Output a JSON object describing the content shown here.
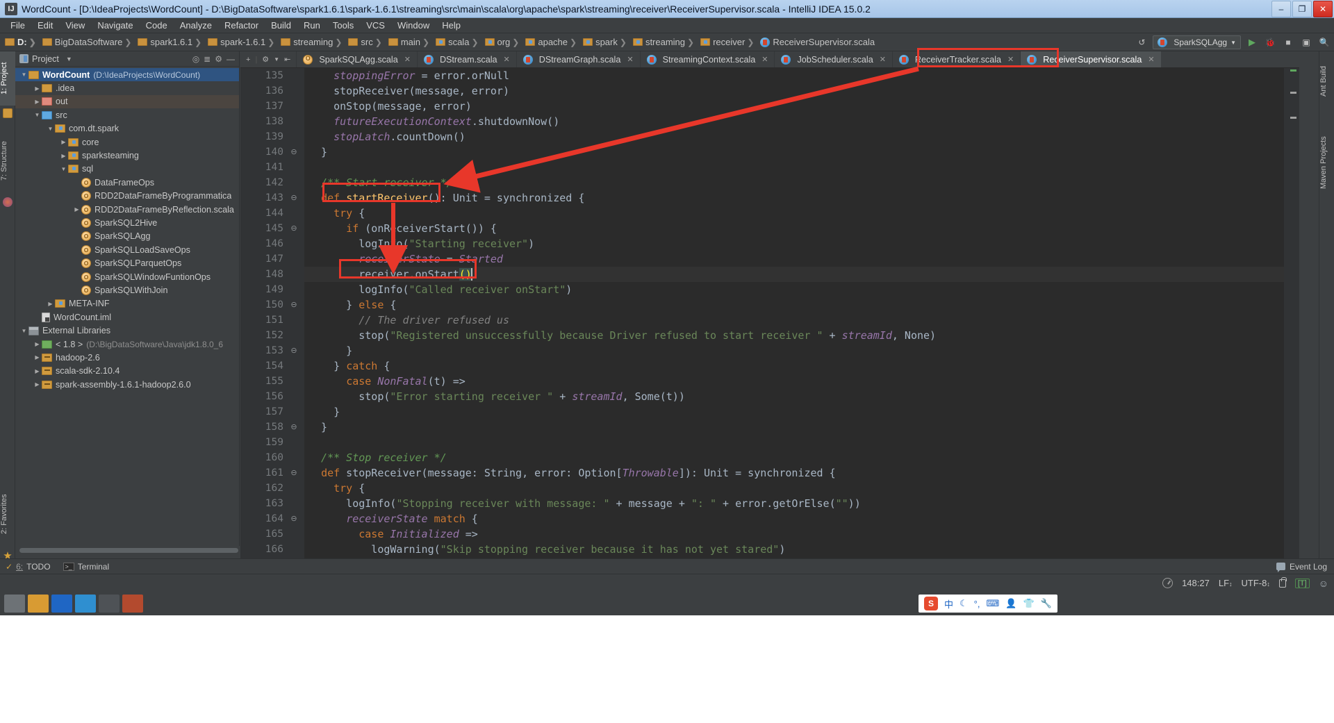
{
  "window": {
    "title": "WordCount - [D:\\IdeaProjects\\WordCount] - D:\\BigDataSoftware\\spark1.6.1\\spark-1.6.1\\streaming\\src\\main\\scala\\org\\apache\\spark\\streaming\\receiver\\ReceiverSupervisor.scala - IntelliJ IDEA 15.0.2",
    "minimize_label": "–",
    "maximize_label": "❐",
    "close_label": "✕",
    "app_icon": "idea-icon"
  },
  "menu": {
    "items": [
      "File",
      "Edit",
      "View",
      "Navigate",
      "Code",
      "Analyze",
      "Refactor",
      "Build",
      "Run",
      "Tools",
      "VCS",
      "Window",
      "Help"
    ]
  },
  "navbar": {
    "crumbs": [
      {
        "label": "D:",
        "icon": "folder-icon",
        "bold": true
      },
      {
        "label": "BigDataSoftware",
        "icon": "folder-icon",
        "bold": false
      },
      {
        "label": "spark1.6.1",
        "icon": "folder-icon",
        "bold": false
      },
      {
        "label": "spark-1.6.1",
        "icon": "folder-icon",
        "bold": false
      },
      {
        "label": "streaming",
        "icon": "folder-icon",
        "bold": false
      },
      {
        "label": "src",
        "icon": "folder-icon",
        "bold": false
      },
      {
        "label": "main",
        "icon": "folder-icon",
        "bold": false
      },
      {
        "label": "scala",
        "icon": "source-folder-icon",
        "bold": false
      },
      {
        "label": "org",
        "icon": "source-folder-icon",
        "bold": false
      },
      {
        "label": "apache",
        "icon": "source-folder-icon",
        "bold": false
      },
      {
        "label": "spark",
        "icon": "source-folder-icon",
        "bold": false
      },
      {
        "label": "streaming",
        "icon": "source-folder-icon",
        "bold": false
      },
      {
        "label": "receiver",
        "icon": "source-folder-icon",
        "bold": false
      },
      {
        "label": "ReceiverSupervisor.scala",
        "icon": "scala-file-icon",
        "bold": false
      }
    ],
    "run_config": "SparkSQLAgg",
    "run_label": "▶",
    "debug_label": "🐞",
    "stop_label": "■",
    "search_label": "🔍",
    "sync_label": "↺"
  },
  "left_tool_strip": {
    "tabs": [
      "1: Project",
      "7: Structure"
    ],
    "favorites": "2: Favorites"
  },
  "right_tool_strip": {
    "tabs": [
      "Ant Build",
      "Maven Projects"
    ]
  },
  "project_panel": {
    "title": "Project",
    "caret": "▼",
    "tree": [
      {
        "depth": 0,
        "arrow": "▼",
        "icon": "project-folder-icon",
        "label": "WordCount",
        "path": "(D:\\IdeaProjects\\WordCount)",
        "bold": true,
        "state": "selected"
      },
      {
        "depth": 1,
        "arrow": "▶",
        "icon": "folder-yellow-icon",
        "label": ".idea",
        "path": "",
        "bold": false,
        "state": "none"
      },
      {
        "depth": 1,
        "arrow": "▶",
        "icon": "folder-red-icon",
        "label": "out",
        "path": "",
        "bold": false,
        "state": "highlight"
      },
      {
        "depth": 1,
        "arrow": "▼",
        "icon": "folder-blue-icon",
        "label": "src",
        "path": "",
        "bold": false,
        "state": "none"
      },
      {
        "depth": 2,
        "arrow": "▼",
        "icon": "package-icon",
        "label": "com.dt.spark",
        "path": "",
        "bold": false,
        "state": "none"
      },
      {
        "depth": 3,
        "arrow": "▶",
        "icon": "package-icon",
        "label": "core",
        "path": "",
        "bold": false,
        "state": "none"
      },
      {
        "depth": 3,
        "arrow": "▶",
        "icon": "package-icon",
        "label": "sparksteaming",
        "path": "",
        "bold": false,
        "state": "none"
      },
      {
        "depth": 3,
        "arrow": "▼",
        "icon": "package-icon",
        "label": "sql",
        "path": "",
        "bold": false,
        "state": "none"
      },
      {
        "depth": 4,
        "arrow": "",
        "icon": "scala-object-icon",
        "label": "DataFrameOps",
        "path": "",
        "bold": false,
        "state": "none"
      },
      {
        "depth": 4,
        "arrow": "",
        "icon": "scala-object-icon",
        "label": "RDD2DataFrameByProgrammatica",
        "path": "",
        "bold": false,
        "state": "none"
      },
      {
        "depth": 4,
        "arrow": "▶",
        "icon": "scala-object-icon",
        "label": "RDD2DataFrameByReflection.scala",
        "path": "",
        "bold": false,
        "state": "none"
      },
      {
        "depth": 4,
        "arrow": "",
        "icon": "scala-object-icon",
        "label": "SparkSQL2Hive",
        "path": "",
        "bold": false,
        "state": "none"
      },
      {
        "depth": 4,
        "arrow": "",
        "icon": "scala-object-icon",
        "label": "SparkSQLAgg",
        "path": "",
        "bold": false,
        "state": "none"
      },
      {
        "depth": 4,
        "arrow": "",
        "icon": "scala-object-icon",
        "label": "SparkSQLLoadSaveOps",
        "path": "",
        "bold": false,
        "state": "none"
      },
      {
        "depth": 4,
        "arrow": "",
        "icon": "scala-object-icon",
        "label": "SparkSQLParquetOps",
        "path": "",
        "bold": false,
        "state": "none"
      },
      {
        "depth": 4,
        "arrow": "",
        "icon": "scala-object-icon",
        "label": "SparkSQLWindowFuntionOps",
        "path": "",
        "bold": false,
        "state": "none"
      },
      {
        "depth": 4,
        "arrow": "",
        "icon": "scala-object-icon",
        "label": "SparkSQLWithJoin",
        "path": "",
        "bold": false,
        "state": "none"
      },
      {
        "depth": 2,
        "arrow": "▶",
        "icon": "package-icon",
        "label": "META-INF",
        "path": "",
        "bold": false,
        "state": "none"
      },
      {
        "depth": 1,
        "arrow": "",
        "icon": "iml-file-icon",
        "label": "WordCount.iml",
        "path": "",
        "bold": false,
        "state": "none"
      },
      {
        "depth": 0,
        "arrow": "▼",
        "icon": "library-icon",
        "label": "External Libraries",
        "path": "",
        "bold": false,
        "state": "none"
      },
      {
        "depth": 1,
        "arrow": "▶",
        "icon": "jdk-icon",
        "label": "< 1.8 >",
        "path": "(D:\\BigDataSoftware\\Java\\jdk1.8.0_6",
        "bold": false,
        "state": "none"
      },
      {
        "depth": 1,
        "arrow": "▶",
        "icon": "jar-icon",
        "label": "hadoop-2.6",
        "path": "",
        "bold": false,
        "state": "none"
      },
      {
        "depth": 1,
        "arrow": "▶",
        "icon": "jar-icon",
        "label": "scala-sdk-2.10.4",
        "path": "",
        "bold": false,
        "state": "none"
      },
      {
        "depth": 1,
        "arrow": "▶",
        "icon": "jar-icon",
        "label": "spark-assembly-1.6.1-hadoop2.6.0",
        "path": "",
        "bold": false,
        "state": "none"
      }
    ]
  },
  "editor_tabs": {
    "tabs": [
      {
        "label": "SparkSQLAgg.scala",
        "icon": "scala-object-icon",
        "active": false,
        "marked": false
      },
      {
        "label": "DStream.scala",
        "icon": "scala-file-icon",
        "active": false,
        "marked": false
      },
      {
        "label": "DStreamGraph.scala",
        "icon": "scala-file-icon",
        "active": false,
        "marked": false
      },
      {
        "label": "StreamingContext.scala",
        "icon": "scala-file-icon",
        "active": false,
        "marked": false
      },
      {
        "label": "JobScheduler.scala",
        "icon": "scala-file-icon",
        "active": false,
        "marked": false
      },
      {
        "label": "ReceiverTracker.scala",
        "icon": "scala-file-icon",
        "active": false,
        "marked": false
      },
      {
        "label": "ReceiverSupervisor.scala",
        "icon": "scala-file-icon",
        "active": true,
        "marked": true
      }
    ],
    "close_label": "✕"
  },
  "editor": {
    "first_line": 135,
    "current_line": 148,
    "lines": [
      {
        "n": 135,
        "fold": "",
        "tokens": [
          {
            "t": "    ",
            "c": "plain"
          },
          {
            "t": "stoppingError",
            "c": "fld"
          },
          {
            "t": " = error.orNull",
            "c": "plain"
          }
        ]
      },
      {
        "n": 136,
        "fold": "",
        "tokens": [
          {
            "t": "    stopReceiver(message, error)",
            "c": "plain"
          }
        ]
      },
      {
        "n": 137,
        "fold": "",
        "tokens": [
          {
            "t": "    onStop(message, error)",
            "c": "plain"
          }
        ]
      },
      {
        "n": 138,
        "fold": "",
        "tokens": [
          {
            "t": "    ",
            "c": "plain"
          },
          {
            "t": "futureExecutionContext",
            "c": "fld"
          },
          {
            "t": ".shutdownNow()",
            "c": "plain"
          }
        ]
      },
      {
        "n": 139,
        "fold": "",
        "tokens": [
          {
            "t": "    ",
            "c": "plain"
          },
          {
            "t": "stopLatch",
            "c": "fld"
          },
          {
            "t": ".countDown()",
            "c": "plain"
          }
        ]
      },
      {
        "n": 140,
        "fold": "⊖",
        "tokens": [
          {
            "t": "  }",
            "c": "plain"
          }
        ]
      },
      {
        "n": 141,
        "fold": "",
        "tokens": [
          {
            "t": "",
            "c": "plain"
          }
        ]
      },
      {
        "n": 142,
        "fold": "",
        "tokens": [
          {
            "t": "  /** Start receiver */",
            "c": "cmt"
          }
        ]
      },
      {
        "n": 143,
        "fold": "⊖",
        "tokens": [
          {
            "t": "  ",
            "c": "plain"
          },
          {
            "t": "def",
            "c": "kw"
          },
          {
            "t": " ",
            "c": "plain"
          },
          {
            "t": "startReceiver",
            "c": "mtd"
          },
          {
            "t": "(): Unit = synchronized {",
            "c": "plain"
          }
        ]
      },
      {
        "n": 144,
        "fold": "",
        "tokens": [
          {
            "t": "    ",
            "c": "plain"
          },
          {
            "t": "try",
            "c": "kw"
          },
          {
            "t": " {",
            "c": "plain"
          }
        ]
      },
      {
        "n": 145,
        "fold": "⊖",
        "tokens": [
          {
            "t": "      ",
            "c": "plain"
          },
          {
            "t": "if",
            "c": "kw"
          },
          {
            "t": " (onReceiverStart()) {",
            "c": "plain"
          }
        ]
      },
      {
        "n": 146,
        "fold": "",
        "tokens": [
          {
            "t": "        logInfo(",
            "c": "plain"
          },
          {
            "t": "\"Starting receiver\"",
            "c": "str"
          },
          {
            "t": ")",
            "c": "plain"
          }
        ]
      },
      {
        "n": 147,
        "fold": "",
        "tokens": [
          {
            "t": "        ",
            "c": "plain"
          },
          {
            "t": "receiverState",
            "c": "fld"
          },
          {
            "t": " = ",
            "c": "plain"
          },
          {
            "t": "Started",
            "c": "fld"
          }
        ]
      },
      {
        "n": 148,
        "fold": "",
        "tokens": [
          {
            "t": "        receiver.onStart",
            "c": "plain"
          },
          {
            "t": "()",
            "c": "caret-par"
          }
        ]
      },
      {
        "n": 149,
        "fold": "",
        "tokens": [
          {
            "t": "        logInfo(",
            "c": "plain"
          },
          {
            "t": "\"Called receiver onStart\"",
            "c": "str"
          },
          {
            "t": ")",
            "c": "plain"
          }
        ]
      },
      {
        "n": 150,
        "fold": "⊖",
        "tokens": [
          {
            "t": "      } ",
            "c": "plain"
          },
          {
            "t": "else",
            "c": "kw"
          },
          {
            "t": " {",
            "c": "plain"
          }
        ]
      },
      {
        "n": 151,
        "fold": "",
        "tokens": [
          {
            "t": "        // The driver refused us",
            "c": "cmt2"
          }
        ]
      },
      {
        "n": 152,
        "fold": "",
        "tokens": [
          {
            "t": "        stop(",
            "c": "plain"
          },
          {
            "t": "\"Registered unsuccessfully because Driver refused to start receiver \"",
            "c": "str"
          },
          {
            "t": " + ",
            "c": "plain"
          },
          {
            "t": "streamId",
            "c": "fld"
          },
          {
            "t": ", None)",
            "c": "plain"
          }
        ]
      },
      {
        "n": 153,
        "fold": "⊖",
        "tokens": [
          {
            "t": "      }",
            "c": "plain"
          }
        ]
      },
      {
        "n": 154,
        "fold": "",
        "tokens": [
          {
            "t": "    } ",
            "c": "plain"
          },
          {
            "t": "catch",
            "c": "kw"
          },
          {
            "t": " {",
            "c": "plain"
          }
        ]
      },
      {
        "n": 155,
        "fold": "",
        "tokens": [
          {
            "t": "      ",
            "c": "plain"
          },
          {
            "t": "case",
            "c": "kw"
          },
          {
            "t": " ",
            "c": "plain"
          },
          {
            "t": "NonFatal",
            "c": "fld"
          },
          {
            "t": "(t) =>",
            "c": "plain"
          }
        ]
      },
      {
        "n": 156,
        "fold": "",
        "tokens": [
          {
            "t": "        stop(",
            "c": "plain"
          },
          {
            "t": "\"Error starting receiver \"",
            "c": "str"
          },
          {
            "t": " + ",
            "c": "plain"
          },
          {
            "t": "streamId",
            "c": "fld"
          },
          {
            "t": ", Some(t))",
            "c": "plain"
          }
        ]
      },
      {
        "n": 157,
        "fold": "",
        "tokens": [
          {
            "t": "    }",
            "c": "plain"
          }
        ]
      },
      {
        "n": 158,
        "fold": "⊖",
        "tokens": [
          {
            "t": "  }",
            "c": "plain"
          }
        ]
      },
      {
        "n": 159,
        "fold": "",
        "tokens": [
          {
            "t": "",
            "c": "plain"
          }
        ]
      },
      {
        "n": 160,
        "fold": "",
        "tokens": [
          {
            "t": "  /** Stop receiver */",
            "c": "cmt"
          }
        ]
      },
      {
        "n": 161,
        "fold": "⊖",
        "tokens": [
          {
            "t": "  ",
            "c": "plain"
          },
          {
            "t": "def",
            "c": "kw"
          },
          {
            "t": " stopReceiver(message: ",
            "c": "plain"
          },
          {
            "t": "String",
            "c": "plain"
          },
          {
            "t": ", error: Option[",
            "c": "plain"
          },
          {
            "t": "Throwable",
            "c": "fld"
          },
          {
            "t": "]): Unit = synchronized {",
            "c": "plain"
          }
        ]
      },
      {
        "n": 162,
        "fold": "",
        "tokens": [
          {
            "t": "    ",
            "c": "plain"
          },
          {
            "t": "try",
            "c": "kw"
          },
          {
            "t": " {",
            "c": "plain"
          }
        ]
      },
      {
        "n": 163,
        "fold": "",
        "tokens": [
          {
            "t": "      logInfo(",
            "c": "plain"
          },
          {
            "t": "\"Stopping receiver with message: \"",
            "c": "str"
          },
          {
            "t": " + message + ",
            "c": "plain"
          },
          {
            "t": "\": \"",
            "c": "str"
          },
          {
            "t": " + error.getOrElse(",
            "c": "plain"
          },
          {
            "t": "\"\"",
            "c": "str"
          },
          {
            "t": "))",
            "c": "plain"
          }
        ]
      },
      {
        "n": 164,
        "fold": "⊖",
        "tokens": [
          {
            "t": "      ",
            "c": "plain"
          },
          {
            "t": "receiverState",
            "c": "fld"
          },
          {
            "t": " ",
            "c": "plain"
          },
          {
            "t": "match",
            "c": "kw"
          },
          {
            "t": " {",
            "c": "plain"
          }
        ]
      },
      {
        "n": 165,
        "fold": "",
        "tokens": [
          {
            "t": "        ",
            "c": "plain"
          },
          {
            "t": "case",
            "c": "kw"
          },
          {
            "t": " ",
            "c": "plain"
          },
          {
            "t": "Initialized",
            "c": "fld"
          },
          {
            "t": " =>",
            "c": "plain"
          }
        ]
      },
      {
        "n": 166,
        "fold": "",
        "tokens": [
          {
            "t": "          logWarning(",
            "c": "plain"
          },
          {
            "t": "\"Skip stopping receiver because it has not yet stared\"",
            "c": "str"
          },
          {
            "t": ")",
            "c": "plain"
          }
        ]
      }
    ]
  },
  "annotations": {
    "box_tab": "ReceiverSupervisor.scala",
    "box_method": "startReceiver():",
    "box_call": "receiver.onStart()",
    "arrow_color": "#e8372a"
  },
  "bottom_bar": {
    "todo_num": "6:",
    "todo_label": "TODO",
    "terminal_label": "Terminal",
    "event_log_label": "Event Log"
  },
  "status_bar": {
    "caret_position": "148:27",
    "line_separator": "LF",
    "encoding": "UTF-8",
    "lock_state": "unlocked",
    "t_badge": "[T]",
    "memory_icon": "memory-indicator"
  },
  "taskbar": {
    "ime_language": "中",
    "ime_items": [
      "sogou-logo",
      "中",
      "moon-icon",
      "comma-icon",
      "keyboard-icon",
      "user-icon",
      "shirt-icon",
      "wrench-icon"
    ]
  }
}
